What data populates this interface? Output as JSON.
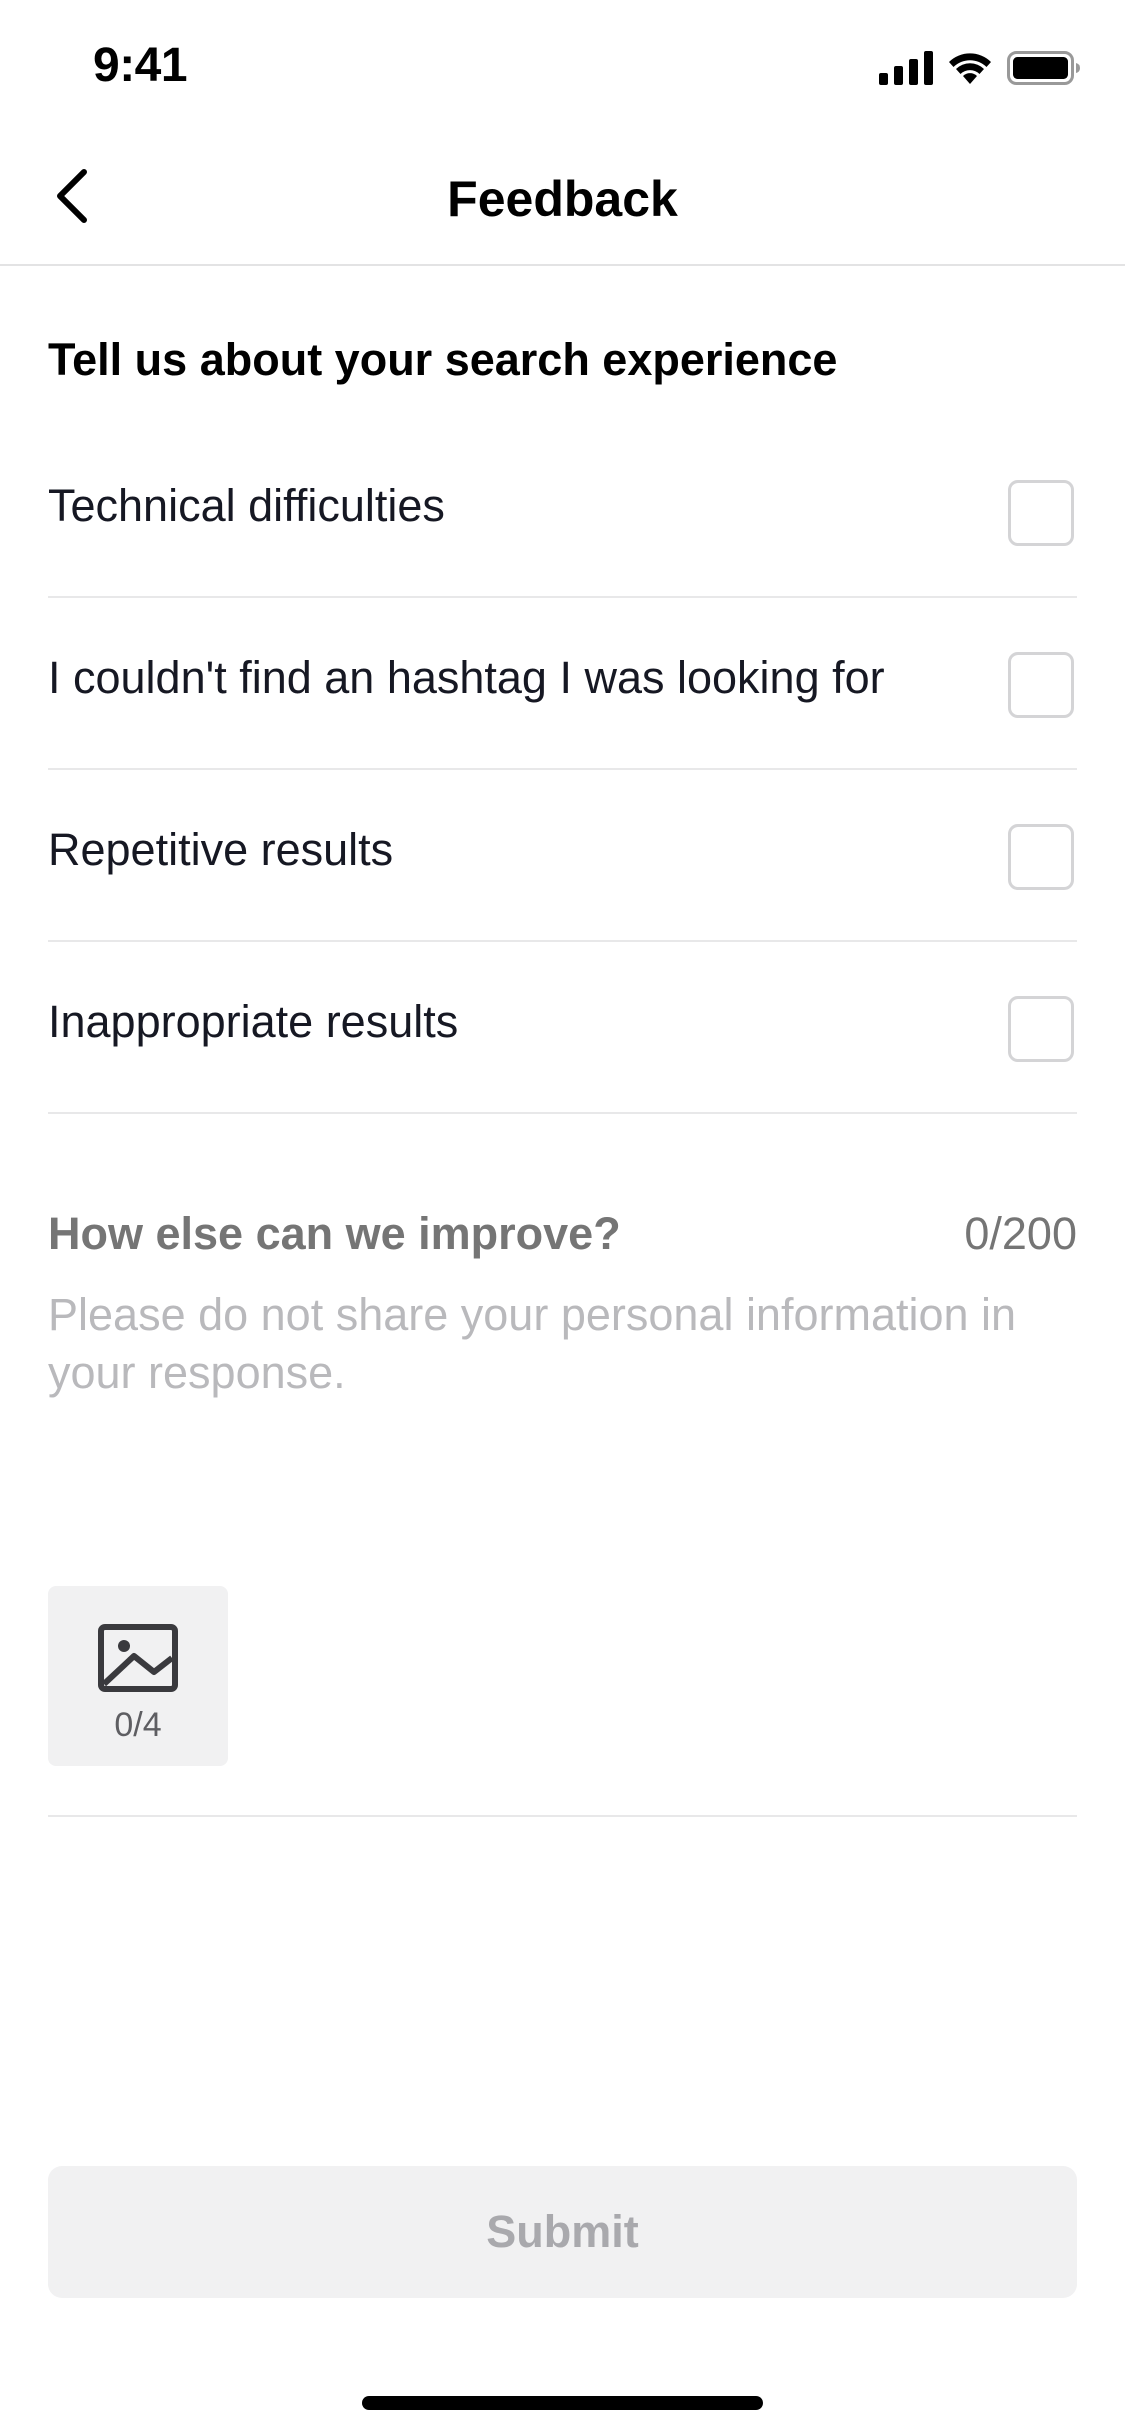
{
  "status_bar": {
    "time": "9:41"
  },
  "nav": {
    "title": "Feedback"
  },
  "section": {
    "title": "Tell us about your search experience"
  },
  "options": [
    {
      "label": "Technical difficulties",
      "checked": false
    },
    {
      "label": "I couldn't find an hashtag I was looking for",
      "checked": false
    },
    {
      "label": "Repetitive results",
      "checked": false
    },
    {
      "label": "Inappropriate results",
      "checked": false
    }
  ],
  "improve": {
    "label": "How else can we improve?",
    "char_count": "0/200",
    "placeholder": "Please do not share your personal information in your response.",
    "value": ""
  },
  "image_upload": {
    "count": "0/4"
  },
  "submit": {
    "label": "Submit"
  },
  "colors": {
    "text_primary": "#161823",
    "text_secondary": "#757575",
    "placeholder": "#b9b9bc",
    "divider": "#e8e8e9",
    "button_disabled_bg": "#f1f1f2",
    "button_disabled_text": "#a9a9ad"
  }
}
